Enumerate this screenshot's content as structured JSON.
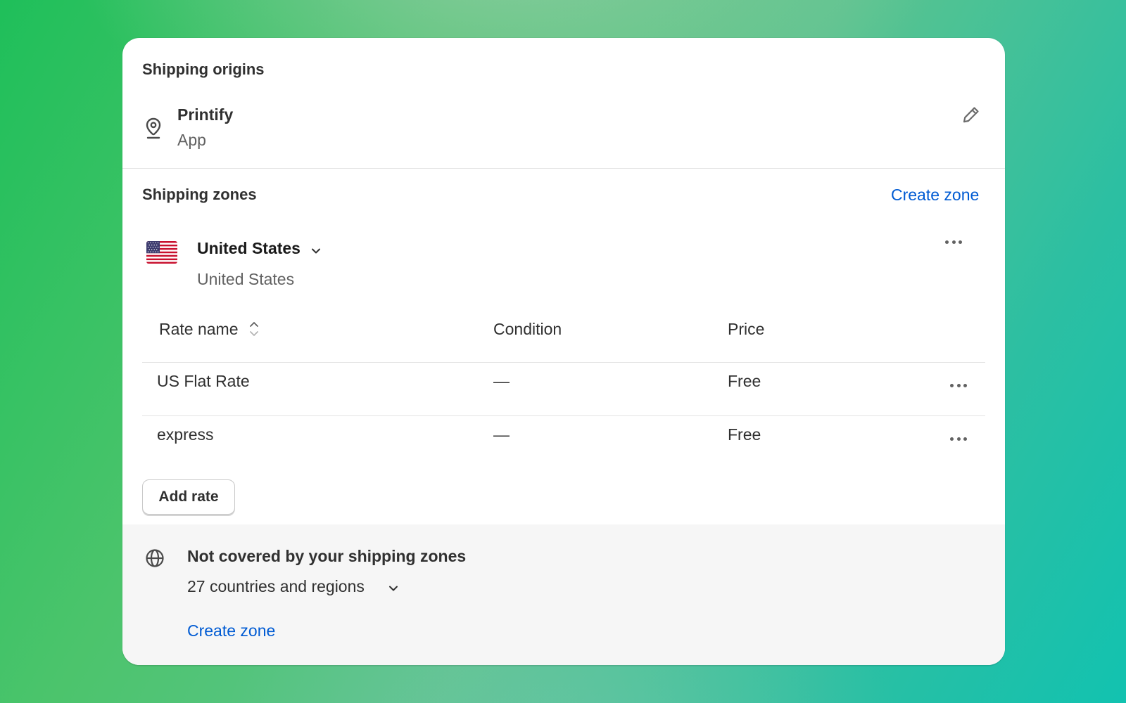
{
  "origins": {
    "title": "Shipping origins",
    "name": "Printify",
    "subtitle": "App",
    "location_icon": "map-pin-icon",
    "edit_icon": "pencil-icon"
  },
  "zones": {
    "title": "Shipping zones",
    "create_link": "Create zone",
    "zone": {
      "name": "United States",
      "countries": "United States",
      "flag_icon": "us-flag-icon",
      "menu_icon": "more-horizontal-icon"
    },
    "table": {
      "headers": [
        "Rate name",
        "Condition",
        "Price"
      ],
      "rows": [
        {
          "name": "US Flat Rate",
          "condition": "—",
          "price": "Free"
        },
        {
          "name": "express",
          "condition": "—",
          "price": "Free"
        }
      ]
    },
    "add_rate": "Add rate"
  },
  "not_covered": {
    "title": "Not covered by your shipping zones",
    "count": "27 countries and regions",
    "create_link": "Create zone",
    "icon": "globe-icon"
  },
  "colors": {
    "link": "#005bd3",
    "text": "#303030",
    "muted": "#616161",
    "footer_bg": "#f6f6f6"
  }
}
